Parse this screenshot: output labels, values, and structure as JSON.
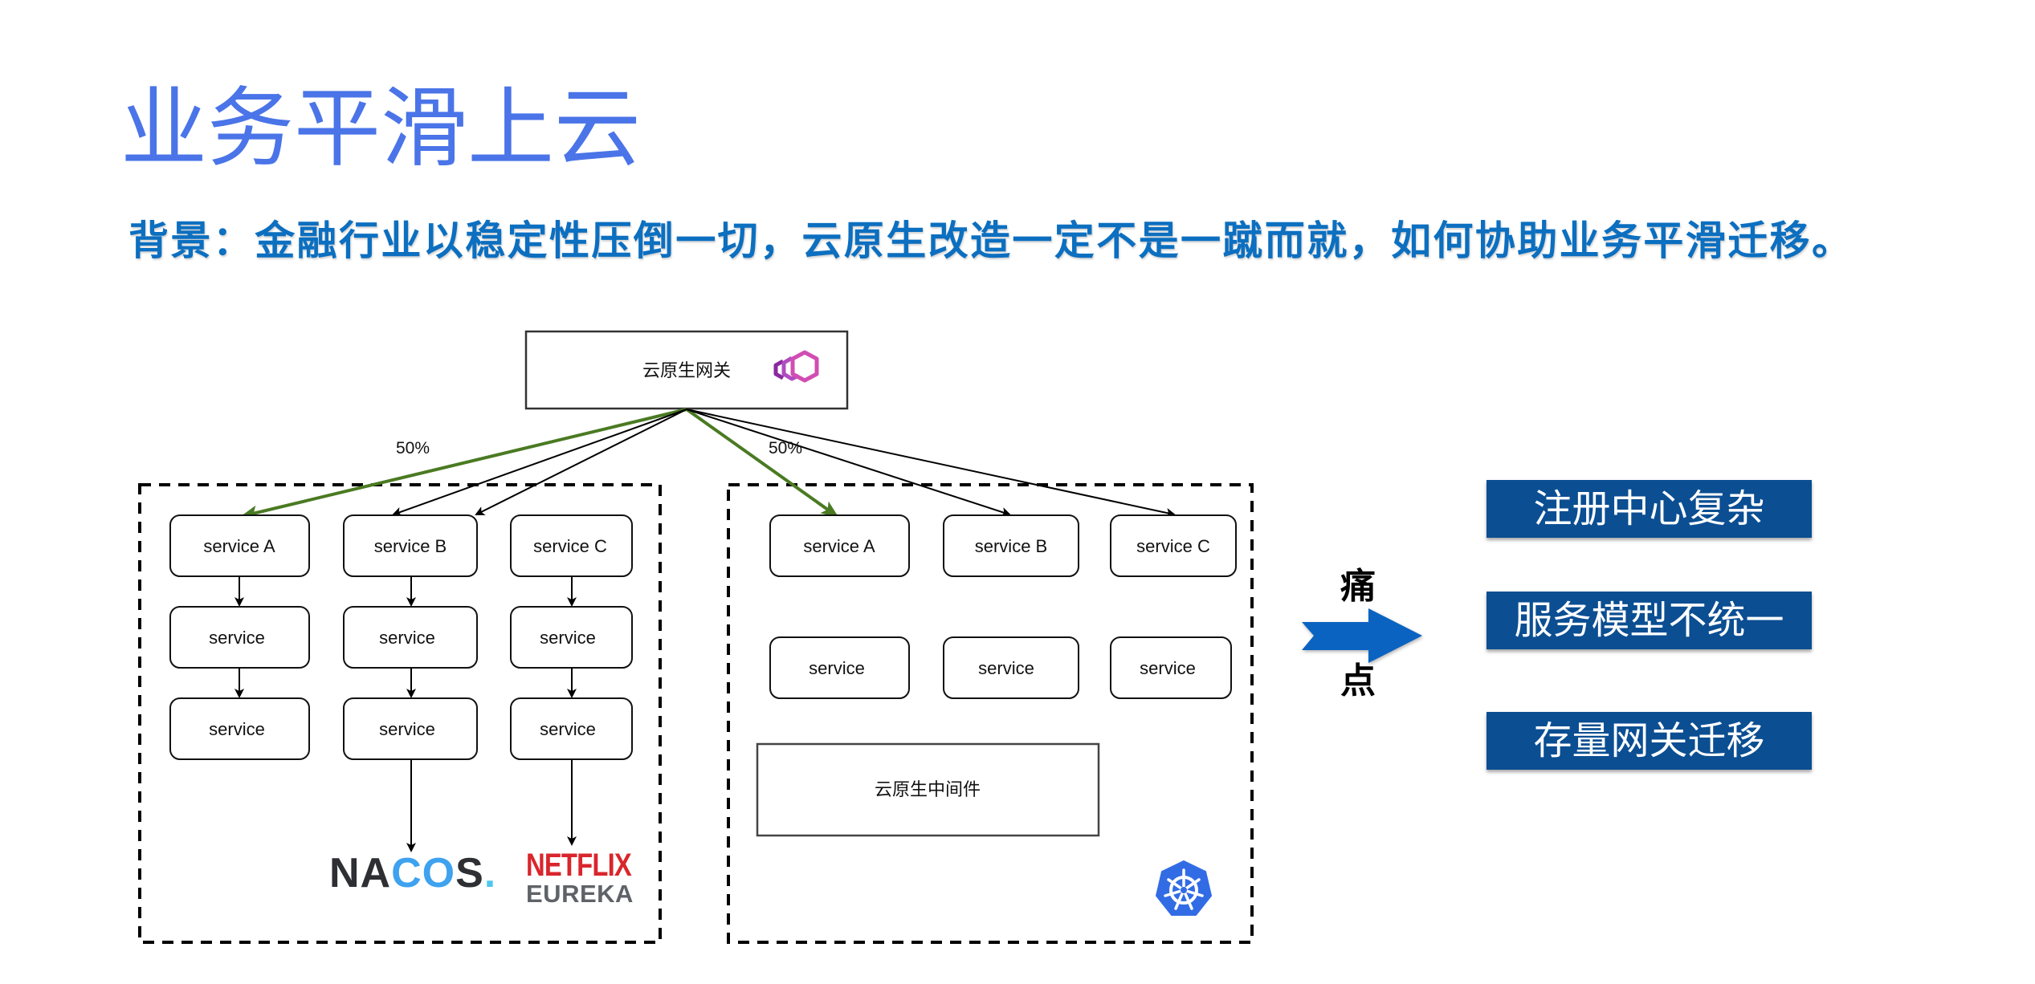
{
  "slide": {
    "title": "业务平滑上云",
    "subtitle": "背景：金融行业以稳定性压倒一切，云原生改造一定不是一蹴而就，如何协助业务平滑迁移。"
  },
  "diagram": {
    "gateway": {
      "label": "云原生网关",
      "icon": "envoy-hexagons-icon"
    },
    "traffic_split": {
      "left_label": "50%",
      "right_label": "50%",
      "highlight_color": "#4A7A22"
    },
    "left_cluster": {
      "columns": [
        {
          "top": "service A",
          "mid": "service",
          "bottom": "service"
        },
        {
          "top": "service B",
          "mid": "service",
          "bottom": "service",
          "registry": "NACOS"
        },
        {
          "top": "service C",
          "mid": "service",
          "bottom": "service",
          "registry": "NETFLIX EUREKA"
        }
      ],
      "registries": {
        "nacos": {
          "prefix": "NA",
          "mid": "CO",
          "suffix": "S",
          "dot": "."
        },
        "eureka": {
          "line1": "NETFLIX",
          "line2": "EUREKA"
        }
      }
    },
    "right_cluster": {
      "top_row": [
        "service A",
        "service B",
        "service C"
      ],
      "second_row": [
        "service",
        "service",
        "service"
      ],
      "middleware": "云原生中间件",
      "icon": "kubernetes-icon"
    }
  },
  "pain_points": {
    "label_top": "痛",
    "label_bottom": "点",
    "arrow_color": "#0B63C1",
    "items": [
      "注册中心复杂",
      "服务模型不统一",
      "存量网关迁移"
    ],
    "item_color": "#0B4E92"
  }
}
